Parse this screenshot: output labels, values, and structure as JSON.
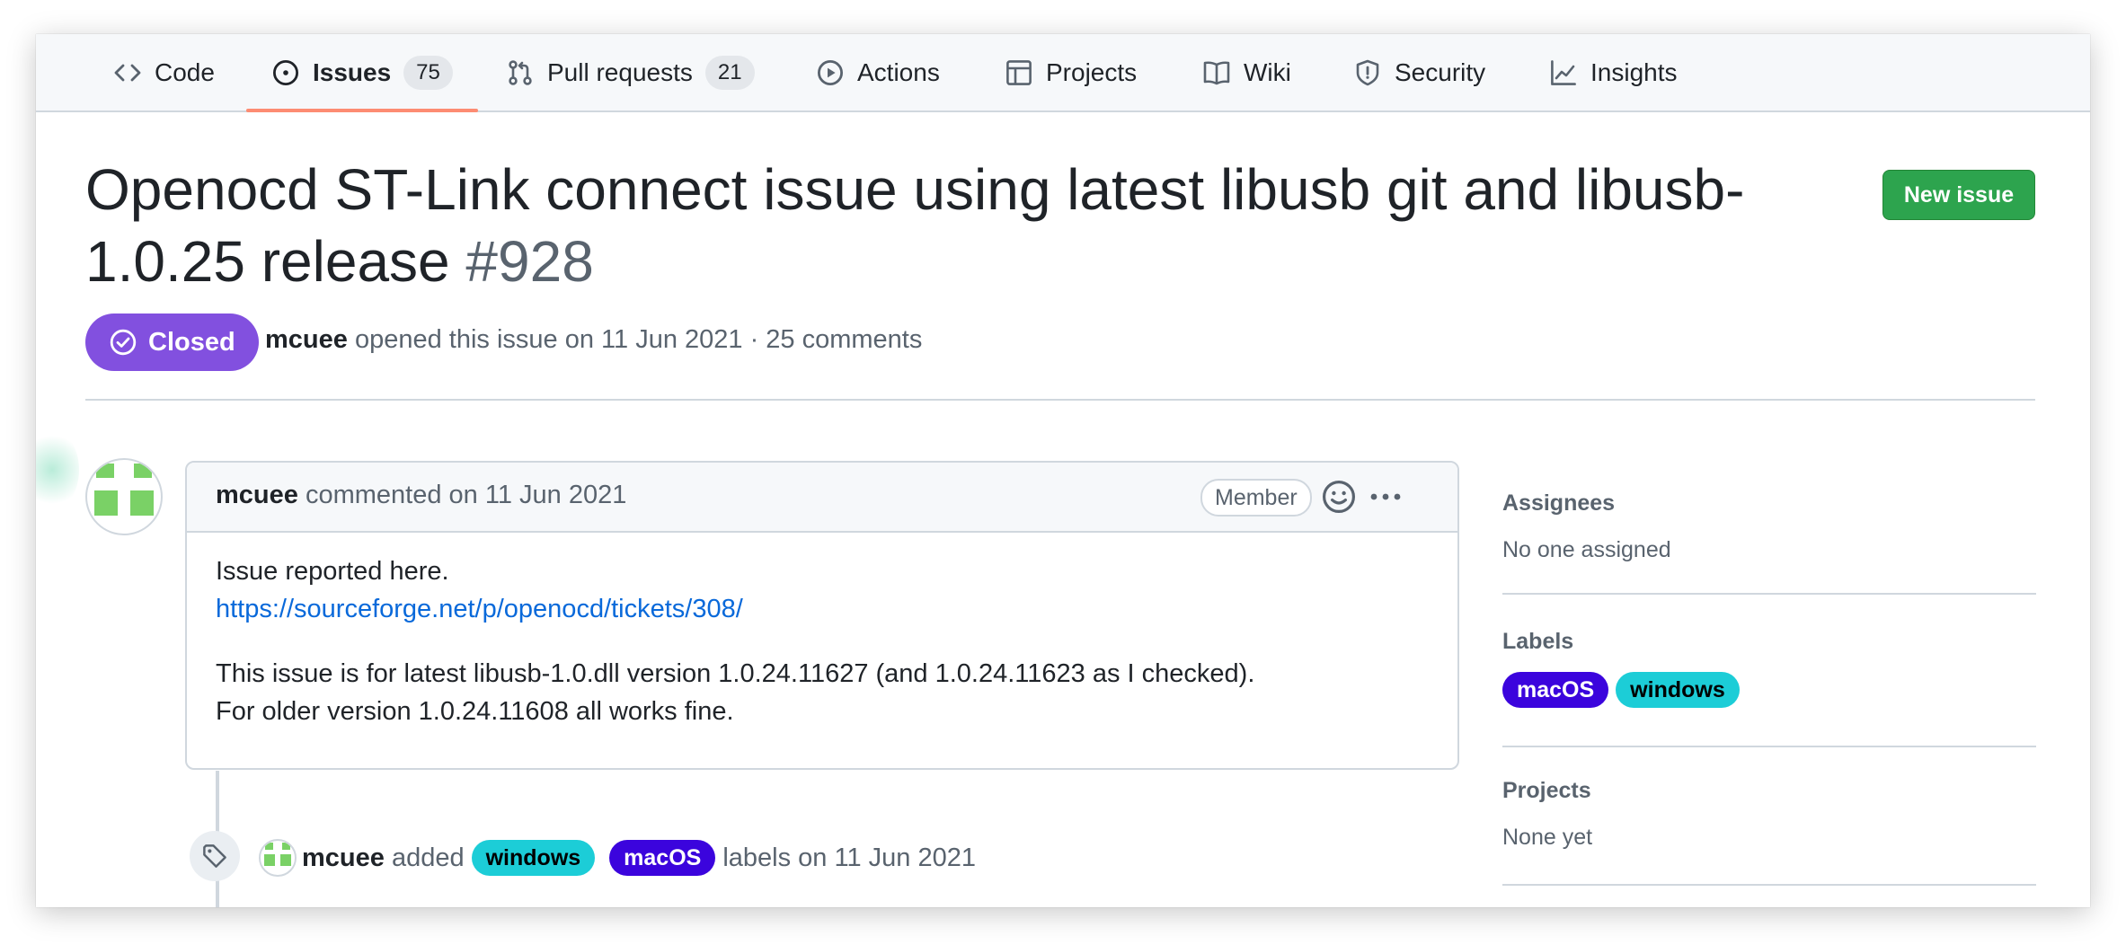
{
  "tabs": [
    {
      "label": "Code",
      "icon": "code-icon"
    },
    {
      "label": "Issues",
      "icon": "issue-opened-icon",
      "count": "75",
      "active": true
    },
    {
      "label": "Pull requests",
      "icon": "git-pull-request-icon",
      "count": "21"
    },
    {
      "label": "Actions",
      "icon": "play-icon"
    },
    {
      "label": "Projects",
      "icon": "table-icon"
    },
    {
      "label": "Wiki",
      "icon": "book-icon"
    },
    {
      "label": "Security",
      "icon": "shield-icon"
    },
    {
      "label": "Insights",
      "icon": "graph-icon"
    }
  ],
  "issue": {
    "title": "Openocd ST-Link connect issue using latest libusb git and libusb-1.0.25 release",
    "number": "#928",
    "state": "Closed",
    "author": "mcuee",
    "meta_text": "opened this issue on 11 Jun 2021 · 25 comments",
    "new_issue_label": "New issue"
  },
  "comment": {
    "author": "mcuee",
    "header_text": "commented on 11 Jun 2021",
    "role": "Member",
    "line1": "Issue reported here.",
    "link": "https://sourceforge.net/p/openocd/tickets/308/",
    "line3": "This issue is for latest libusb-1.0.dll version 1.0.24.11627 (and 1.0.24.11623 as I checked).",
    "line4": "For older version 1.0.24.11608 all works fine."
  },
  "event": {
    "actor": "mcuee",
    "action": "added",
    "labels": [
      "windows",
      "macOS"
    ],
    "suffix": "labels on 11 Jun 2021"
  },
  "sidebar": {
    "assignees_title": "Assignees",
    "assignees_value": "No one assigned",
    "labels_title": "Labels",
    "labels": [
      "macOS",
      "windows"
    ],
    "projects_title": "Projects",
    "projects_value": "None yet"
  },
  "colors": {
    "closed_badge": "#8250df",
    "new_issue_button": "#2da44e",
    "active_tab_underline": "#fd8c73",
    "link": "#0969da",
    "label_macos": "#3b04dd",
    "label_windows": "#1ccdd7"
  }
}
